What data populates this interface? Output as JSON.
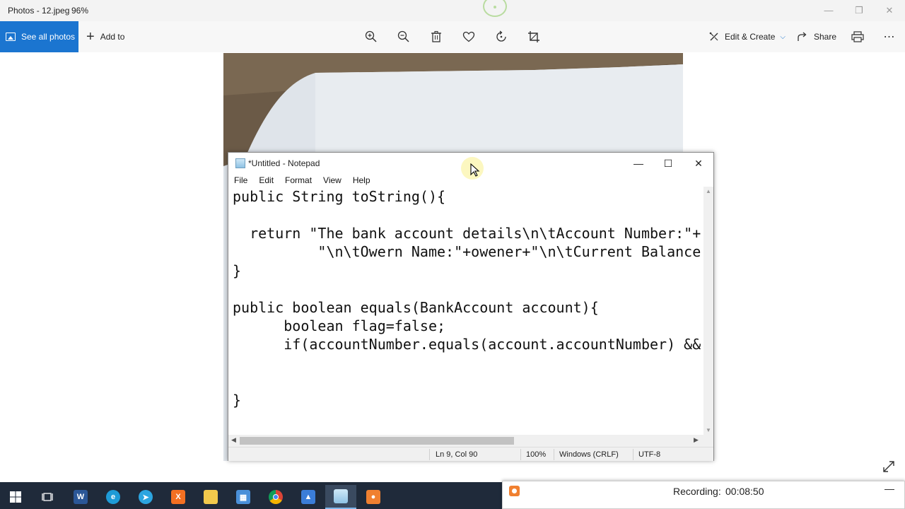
{
  "photos": {
    "window_title": "Photos - 12.jpeg",
    "zoom": "96%",
    "see_all_label": "See all photos",
    "add_to_label": "Add to",
    "edit_create_label": "Edit & Create",
    "share_label": "Share"
  },
  "notepad": {
    "title": "*Untitled - Notepad",
    "menu": [
      "File",
      "Edit",
      "Format",
      "View",
      "Help"
    ],
    "lines": [
      "public String toString(){",
      "",
      "  return \"The bank account details\\n\\tAccount Number:\"+",
      "          \"\\n\\tOwern Name:\"+owener+\"\\n\\tCurrent Balance",
      "}",
      "",
      "public boolean equals(BankAccount account){",
      "      boolean flag=false;",
      "      if(accountNumber.equals(account.accountNumber) &&",
      "",
      "",
      "}"
    ],
    "status": {
      "position": "Ln 9, Col 90",
      "zoom": "100%",
      "line_ending": "Windows (CRLF)",
      "encoding": "UTF-8"
    }
  },
  "recording": {
    "label": "Recording:",
    "time": "00:08:50"
  },
  "colors": {
    "accent": "#1b75d0",
    "taskbar": "#1f2a3a"
  }
}
